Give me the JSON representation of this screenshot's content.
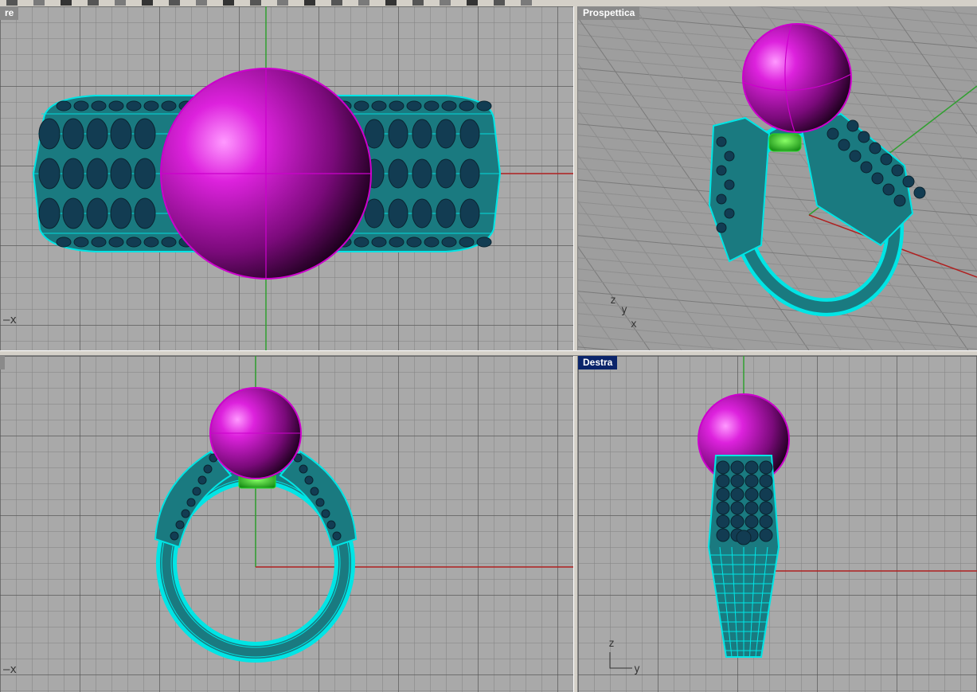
{
  "viewports": {
    "top": {
      "title": "re",
      "axis_label": "x"
    },
    "perspective": {
      "title": "Prospettica",
      "axis_z": "z",
      "axis_y": "y",
      "axis_x": "x"
    },
    "front": {
      "title": "",
      "axis_label": "x"
    },
    "right": {
      "title": "Destra",
      "axis_z": "z",
      "axis_y": "y"
    }
  },
  "colors": {
    "grid_bg": "#a9a9a9",
    "wireframe": "#00e5e5",
    "pearl": "#cc00cc",
    "setting": "#22dd22",
    "axis_x": "#b02020",
    "axis_y": "#30a030",
    "active_title": "#0a246a"
  },
  "toolbar_icons": [
    "open-icon",
    "save-icon",
    "print-icon",
    "undo-icon",
    "redo-icon",
    "cut-icon",
    "copy-icon",
    "paste-icon",
    "pan-icon",
    "rotate-icon",
    "zoom-icon",
    "zoom-window-icon",
    "zoom-extents-icon",
    "select-icon",
    "layer-icon",
    "properties-icon",
    "render-icon",
    "shade-icon",
    "osnap-icon",
    "help-icon"
  ]
}
